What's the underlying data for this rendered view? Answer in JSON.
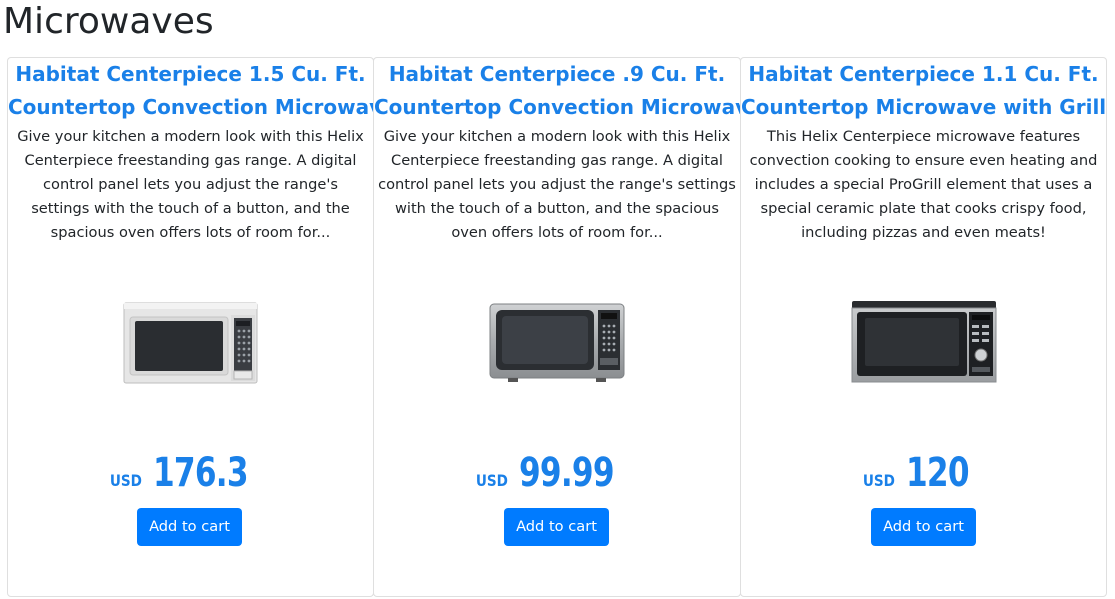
{
  "page": {
    "title": "Microwaves"
  },
  "products": [
    {
      "title_line1": "Habitat Centerpiece 1.5 Cu. Ft.",
      "title_line2": "Countertop Convection Microwave",
      "description": "Give your kitchen a modern look with this Helix Centerpiece freestanding gas range. A digital control panel lets you adjust the range's settings with the touch of a button, and the spacious oven offers lots of room for...",
      "currency": "USD",
      "price": "176.3",
      "button_label": "Add to cart",
      "image_icon": "microwave-white-icon"
    },
    {
      "title_line1": "Habitat Centerpiece .9 Cu. Ft.",
      "title_line2": "Countertop Convection Microwave",
      "description": "Give your kitchen a modern look with this Helix Centerpiece freestanding gas range. A digital control panel lets you adjust the range's settings with the touch of a button, and the spacious oven offers lots of room for...",
      "currency": "USD",
      "price": "99.99",
      "button_label": "Add to cart",
      "image_icon": "microwave-steel-icon"
    },
    {
      "title_line1": "Habitat Centerpiece 1.1 Cu. Ft.",
      "title_line2": "Countertop Microwave with Grill",
      "description": "This Helix Centerpiece microwave features convection cooking to ensure even heating and includes a special ProGrill element that uses a special ceramic plate that cooks crispy food, including pizzas and even meats!",
      "currency": "USD",
      "price": "120",
      "button_label": "Add to cart",
      "image_icon": "microwave-black-steel-icon"
    }
  ],
  "colors": {
    "accent": "#1a80e8",
    "button": "#007bff",
    "text": "#212529"
  }
}
